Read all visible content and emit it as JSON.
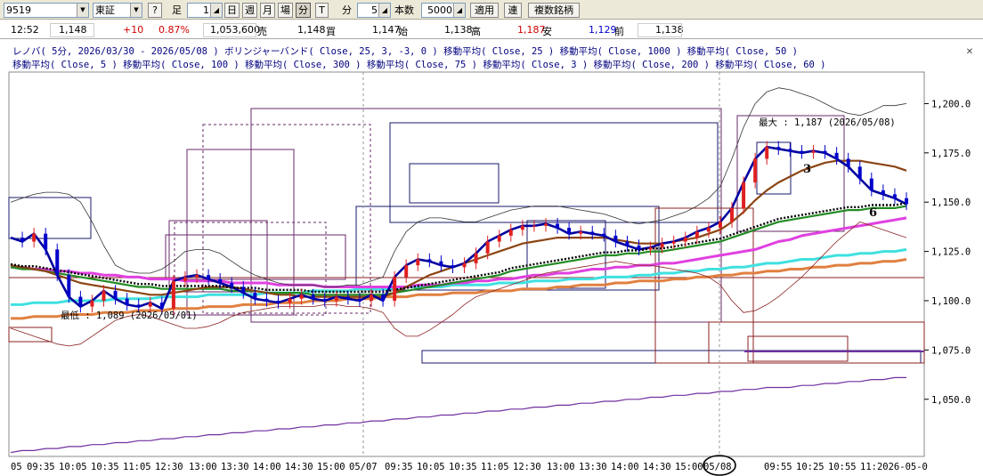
{
  "toolbar": {
    "code": "9519",
    "exchange": "東証",
    "help": "?",
    "ashi_label": "足",
    "ashi_value": "1",
    "periods": [
      "日",
      "週",
      "月",
      "場",
      "分",
      "T"
    ],
    "fun_label": "分",
    "fun_value": "5",
    "count_label": "本数",
    "count_value": "5000",
    "apply": "適用",
    "ren": "連",
    "multi": "複数銘柄"
  },
  "quote": {
    "time": "12:52",
    "price": "1,148",
    "change": "+10",
    "change_pct": "0.87%",
    "volume": "1,053,600",
    "sell_label": "売",
    "sell": "1,148",
    "buy_label": "買",
    "buy": "1,147",
    "open_label": "始",
    "open": "1,138",
    "high_label": "高",
    "high": "1,187",
    "low_label": "安",
    "low": "1,129",
    "prev_label": "前",
    "prev": "1,138"
  },
  "legend": {
    "line1": "レノバ( 5分, 2026/03/30 - 2026/05/08 )  ボリンジャーバンド( Close, 25, 3, -3, 0 )  移動平均( Close, 25 )  移動平均( Close, 1000 )  移動平均( Close, 50 )",
    "line2": "移動平均( Close, 5 )  移動平均( Close, 100 )  移動平均( Close, 300 )  移動平均( Close, 75 )  移動平均( Close, 3 )  移動平均( Close, 200 )  移動平均( Close, 60 )"
  },
  "colors": {
    "up": "#e02020",
    "down": "#0000cc",
    "ma5": "#0000a0",
    "ma25": "#8b4513",
    "ma50": "#228b22",
    "ma75": "#000000",
    "ma100": "#e040e0",
    "ma200": "#40e0e0",
    "ma300": "#e08040",
    "ma1000": "#7030a0"
  },
  "chart_data": {
    "type": "line",
    "title": "",
    "y_ticks": [
      "1,200.0",
      "1,175.0",
      "1,150.0",
      "1,125.0",
      "1,100.0",
      "1,075.0",
      "1,050.0"
    ],
    "y_tick_values": [
      1200,
      1175,
      1150,
      1125,
      1100,
      1075,
      1050
    ],
    "ylim": [
      1021,
      1216
    ],
    "x_ticks": [
      "05",
      "09:35",
      "10:05",
      "10:35",
      "11:05",
      "12:30",
      "13:00",
      "13:30",
      "14:00",
      "14:30",
      "15:00",
      "05/07",
      "09:35",
      "10:05",
      "10:35",
      "11:05",
      "12:30",
      "13:00",
      "13:30",
      "14:00",
      "14:30",
      "15:00",
      "05/08",
      "09:55",
      "10:25",
      "10:55",
      "11:2026-05-0"
    ],
    "annotations": {
      "max": "最大 : 1,187 (2026/05/08)",
      "min": "最低 : 1,089 (2026/05/01)",
      "wave3": "3",
      "wave6": "6"
    },
    "series": [
      {
        "name": "移動平均( Close, 5 )",
        "values": [
          1132,
          1130,
          1134,
          1126,
          1113,
          1102,
          1097,
          1100,
          1105,
          1101,
          1098,
          1097,
          1099,
          1096,
          1110,
          1112,
          1113,
          1111,
          1109,
          1107,
          1104,
          1101,
          1100,
          1099,
          1101,
          1103,
          1101,
          1100,
          1102,
          1101,
          1100,
          1103,
          1100,
          1112,
          1118,
          1121,
          1120,
          1118,
          1117,
          1119,
          1124,
          1130,
          1133,
          1136,
          1138,
          1138,
          1139,
          1137,
          1134,
          1135,
          1134,
          1133,
          1130,
          1128,
          1126,
          1127,
          1129,
          1130,
          1132,
          1135,
          1137,
          1140,
          1147,
          1160,
          1172,
          1178,
          1177,
          1176,
          1175,
          1176,
          1175,
          1172,
          1168,
          1162,
          1156,
          1154,
          1152,
          1149
        ]
      },
      {
        "name": "移動平均( Close, 25 )",
        "values": [
          1118,
          1117,
          1116,
          1115,
          1113,
          1111,
          1109,
          1108,
          1107,
          1106,
          1105,
          1104,
          1103,
          1103,
          1104,
          1105,
          1106,
          1107,
          1107,
          1107,
          1106,
          1105,
          1104,
          1103,
          1103,
          1102,
          1102,
          1102,
          1102,
          1102,
          1102,
          1102,
          1102,
          1104,
          1107,
          1110,
          1113,
          1115,
          1117,
          1119,
          1121,
          1123,
          1125,
          1127,
          1129,
          1130,
          1131,
          1132,
          1132,
          1132,
          1132,
          1132,
          1131,
          1130,
          1129,
          1129,
          1129,
          1130,
          1131,
          1132,
          1134,
          1136,
          1140,
          1145,
          1151,
          1156,
          1160,
          1163,
          1166,
          1168,
          1170,
          1171,
          1171,
          1171,
          1170,
          1169,
          1168,
          1166
        ]
      },
      {
        "name": "移動平均( Close, 50 )",
        "values": [
          1117,
          1116,
          1116,
          1115,
          1114,
          1113,
          1112,
          1111,
          1110,
          1109,
          1108,
          1107,
          1107,
          1106,
          1106,
          1106,
          1106,
          1106,
          1106,
          1105,
          1105,
          1105,
          1104,
          1104,
          1104,
          1104,
          1103,
          1103,
          1103,
          1103,
          1103,
          1103,
          1103,
          1104,
          1105,
          1106,
          1107,
          1108,
          1109,
          1110,
          1111,
          1112,
          1113,
          1115,
          1116,
          1117,
          1118,
          1119,
          1120,
          1121,
          1122,
          1123,
          1123,
          1124,
          1124,
          1125,
          1125,
          1126,
          1127,
          1128,
          1129,
          1130,
          1132,
          1134,
          1136,
          1138,
          1140,
          1141,
          1142,
          1143,
          1144,
          1145,
          1146,
          1146,
          1147,
          1147,
          1147,
          1148
        ]
      },
      {
        "name": "移動平均( Close, 100 )",
        "values": [
          1117,
          1117,
          1116,
          1116,
          1115,
          1115,
          1114,
          1114,
          1113,
          1113,
          1112,
          1112,
          1111,
          1111,
          1111,
          1110,
          1110,
          1110,
          1110,
          1109,
          1109,
          1109,
          1109,
          1108,
          1108,
          1108,
          1108,
          1107,
          1107,
          1107,
          1107,
          1107,
          1107,
          1107,
          1107,
          1108,
          1108,
          1108,
          1109,
          1109,
          1110,
          1110,
          1111,
          1111,
          1112,
          1113,
          1113,
          1114,
          1114,
          1115,
          1116,
          1116,
          1117,
          1117,
          1118,
          1118,
          1119,
          1119,
          1120,
          1121,
          1122,
          1123,
          1124,
          1125,
          1126,
          1128,
          1130,
          1131,
          1133,
          1134,
          1135,
          1136,
          1137,
          1138,
          1139,
          1140,
          1141,
          1142
        ]
      },
      {
        "name": "移動平均( Close, 200 )",
        "values": [
          1098,
          1098,
          1099,
          1099,
          1099,
          1100,
          1100,
          1100,
          1100,
          1101,
          1101,
          1101,
          1101,
          1102,
          1102,
          1102,
          1102,
          1103,
          1103,
          1103,
          1103,
          1103,
          1104,
          1104,
          1104,
          1104,
          1105,
          1105,
          1105,
          1105,
          1106,
          1106,
          1106,
          1106,
          1107,
          1107,
          1107,
          1107,
          1108,
          1108,
          1108,
          1108,
          1109,
          1109,
          1109,
          1110,
          1110,
          1110,
          1111,
          1111,
          1111,
          1112,
          1112,
          1112,
          1113,
          1113,
          1114,
          1114,
          1115,
          1115,
          1116,
          1116,
          1117,
          1117,
          1118,
          1119,
          1119,
          1120,
          1121,
          1121,
          1122,
          1123,
          1123,
          1124,
          1124,
          1125,
          1125,
          1126
        ]
      },
      {
        "name": "移動平均( Close, 300 )",
        "values": [
          1091,
          1091,
          1092,
          1092,
          1092,
          1093,
          1093,
          1093,
          1094,
          1094,
          1094,
          1095,
          1095,
          1095,
          1096,
          1096,
          1096,
          1097,
          1097,
          1097,
          1098,
          1098,
          1098,
          1099,
          1099,
          1099,
          1100,
          1100,
          1100,
          1101,
          1101,
          1101,
          1102,
          1102,
          1102,
          1103,
          1103,
          1103,
          1104,
          1104,
          1104,
          1105,
          1105,
          1105,
          1106,
          1106,
          1106,
          1107,
          1107,
          1108,
          1108,
          1108,
          1109,
          1109,
          1110,
          1110,
          1110,
          1111,
          1111,
          1112,
          1112,
          1113,
          1113,
          1114,
          1114,
          1115,
          1115,
          1116,
          1116,
          1117,
          1117,
          1118,
          1118,
          1119,
          1119,
          1120,
          1120,
          1121
        ]
      },
      {
        "name": "移動平均( Close, 1000 )",
        "values": [
          1023,
          1024,
          1024,
          1025,
          1025,
          1026,
          1026,
          1027,
          1027,
          1028,
          1028,
          1029,
          1029,
          1030,
          1030,
          1031,
          1031,
          1032,
          1032,
          1033,
          1033,
          1034,
          1034,
          1035,
          1035,
          1036,
          1036,
          1037,
          1037,
          1038,
          1038,
          1039,
          1039,
          1040,
          1040,
          1041,
          1041,
          1042,
          1042,
          1043,
          1043,
          1044,
          1044,
          1045,
          1045,
          1046,
          1046,
          1047,
          1047,
          1048,
          1048,
          1049,
          1049,
          1050,
          1050,
          1051,
          1051,
          1052,
          1052,
          1053,
          1053,
          1054,
          1054,
          1055,
          1055,
          1056,
          1056,
          1056,
          1057,
          1057,
          1058,
          1058,
          1059,
          1059,
          1060,
          1060,
          1061,
          1061
        ]
      },
      {
        "name": "ボリンジャーバンド( Close, 25, 3, -3, 0 )",
        "values": [
          1150,
          1152,
          1154,
          1155,
          1155,
          1154,
          1150,
          1140,
          1128,
          1118,
          1115,
          1114,
          1114,
          1116,
          1120,
          1125,
          1126,
          1126,
          1124,
          1120,
          1116,
          1113,
          1111,
          1109,
          1108,
          1108,
          1108,
          1107,
          1107,
          1108,
          1108,
          1110,
          1112,
          1125,
          1135,
          1140,
          1142,
          1142,
          1141,
          1140,
          1140,
          1142,
          1144,
          1146,
          1147,
          1148,
          1148,
          1148,
          1147,
          1146,
          1145,
          1144,
          1142,
          1140,
          1139,
          1140,
          1141,
          1143,
          1145,
          1148,
          1152,
          1158,
          1172,
          1188,
          1200,
          1206,
          1208,
          1207,
          1205,
          1203,
          1200,
          1197,
          1195,
          1194,
          1196,
          1199,
          1199,
          1200
        ]
      },
      {
        "name": "ボリンジャーバンド下限",
        "values": [
          1086,
          1084,
          1082,
          1080,
          1078,
          1077,
          1078,
          1082,
          1086,
          1090,
          1092,
          1093,
          1092,
          1090,
          1088,
          1086,
          1086,
          1087,
          1089,
          1092,
          1094,
          1095,
          1096,
          1097,
          1097,
          1097,
          1097,
          1098,
          1098,
          1097,
          1097,
          1096,
          1094,
          1086,
          1082,
          1082,
          1085,
          1089,
          1093,
          1098,
          1102,
          1104,
          1106,
          1108,
          1110,
          1112,
          1114,
          1115,
          1116,
          1117,
          1118,
          1119,
          1120,
          1119,
          1118,
          1118,
          1117,
          1116,
          1115,
          1114,
          1112,
          1108,
          1100,
          1094,
          1095,
          1098,
          1102,
          1107,
          1112,
          1118,
          1124,
          1130,
          1135,
          1140,
          1138,
          1136,
          1134,
          1132
        ]
      }
    ]
  }
}
